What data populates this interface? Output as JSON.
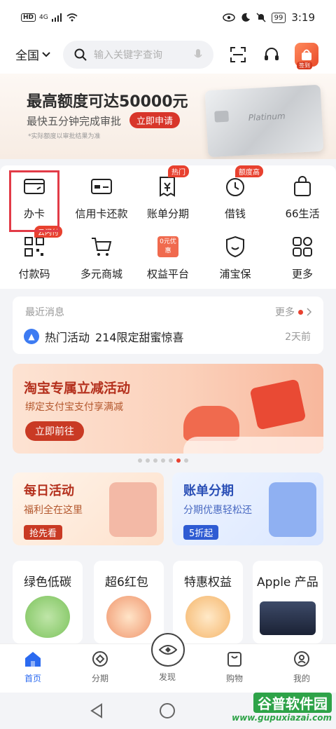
{
  "status": {
    "hd": "HD",
    "net": "4G",
    "battery": "99",
    "time": "3:19"
  },
  "header": {
    "city": "全国",
    "search_placeholder": "输入关键字查询",
    "avatar_tag": "签到"
  },
  "banner": {
    "title": "最高额度可达50000元",
    "subtitle": "最快五分钟完成审批",
    "cta": "立即申请",
    "note": "*实际额度以审批结果为准",
    "card_text": "Platinum"
  },
  "grid": [
    {
      "label": "办卡",
      "badge": ""
    },
    {
      "label": "信用卡还款",
      "badge": ""
    },
    {
      "label": "账单分期",
      "badge": "热门"
    },
    {
      "label": "借钱",
      "badge": "额度高"
    },
    {
      "label": "66生活",
      "badge": ""
    },
    {
      "label": "付款码",
      "badge": "云闪付"
    },
    {
      "label": "多元商城",
      "badge": ""
    },
    {
      "label": "权益平台",
      "badge": "",
      "icon_text": "0元优惠"
    },
    {
      "label": "浦宝保",
      "badge": ""
    },
    {
      "label": "更多",
      "badge": ""
    }
  ],
  "messages": {
    "title": "最近消息",
    "more": "更多",
    "tag": "热门活动",
    "text": "214限定甜蜜惊喜",
    "time": "2天前"
  },
  "promo": {
    "title": "淘宝专属立减活动",
    "subtitle": "绑定支付宝支付享满减",
    "cta": "立即前往"
  },
  "daily": {
    "title": "每日活动",
    "subtitle": "福利全在这里",
    "cta": "抢先看"
  },
  "bill": {
    "title": "账单分期",
    "subtitle": "分期优惠轻松还",
    "cta": "5折起"
  },
  "tiles": [
    {
      "label": "绿色低碳"
    },
    {
      "label": "超6红包"
    },
    {
      "label": "特惠权益"
    },
    {
      "label": "Apple 产品"
    }
  ],
  "tabs": [
    {
      "label": "首页",
      "active": true
    },
    {
      "label": "分期"
    },
    {
      "label": "发现"
    },
    {
      "label": "购物"
    },
    {
      "label": "我的"
    }
  ],
  "watermark": {
    "line1": "谷普软件园",
    "line2": "www.gupuxiazai.com"
  }
}
